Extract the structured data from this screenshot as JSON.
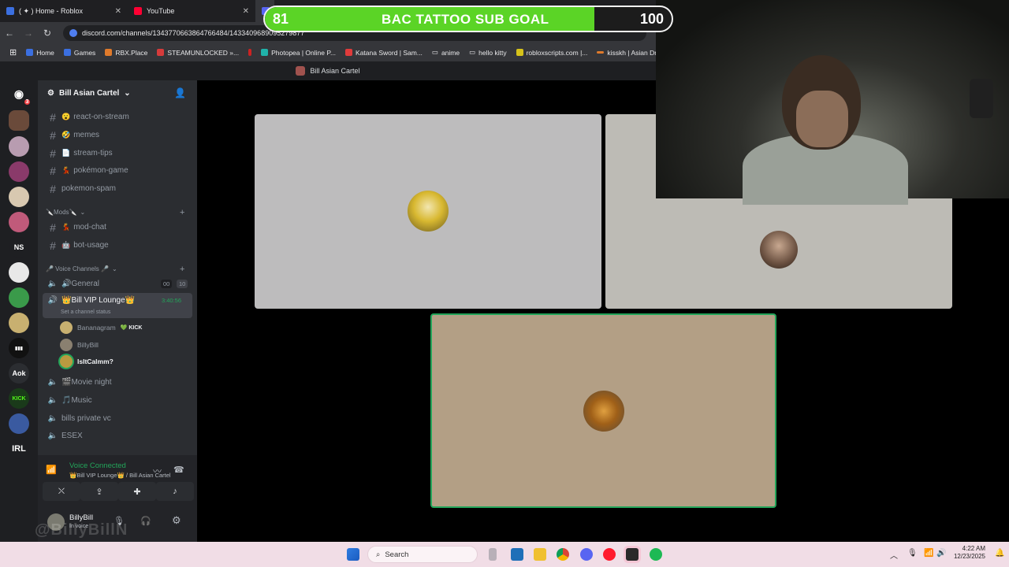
{
  "browser": {
    "tabs": [
      {
        "label": "( ✦ ) Home - Roblox",
        "color": "#3b6fe0"
      },
      {
        "label": "YouTube",
        "color": "#ff0033"
      }
    ],
    "url": "discord.com/channels/1343770663864766484/1433409689095279877",
    "bookmarks": [
      {
        "label": "Home",
        "color": "#3b6fe0"
      },
      {
        "label": "Games",
        "color": "#3b6fe0"
      },
      {
        "label": "RBX.Place",
        "color": "#e07a2b"
      },
      {
        "label": "STEAMUNLOCKED »...",
        "color": "#d63b3b"
      },
      {
        "label": "Photopea | Online P...",
        "color": "#20b2aa"
      },
      {
        "label": "Katana Sword | Sam...",
        "color": "#e03b3b"
      },
      {
        "label": "anime",
        "color": "folder"
      },
      {
        "label": "hello kitty",
        "color": "folder"
      },
      {
        "label": "robloxscripts.com |...",
        "color": "#d6c21a"
      },
      {
        "label": "kisskh | Asian Dram...",
        "color": "#e07a2b"
      }
    ]
  },
  "goal": {
    "current": "81",
    "title": "BAC TATTOO SUB GOAL",
    "target": "100",
    "progress": 0.81,
    "fill_color": "#5bd426"
  },
  "discord": {
    "window_title": "Bill Asian Cartel",
    "server_name": "Bill Asian Cartel",
    "text_channels": [
      {
        "emoji": "😮",
        "name": "react-on-stream"
      },
      {
        "emoji": "🤣",
        "name": "memes"
      },
      {
        "emoji": "📄",
        "name": "stream-tips"
      },
      {
        "emoji": "💃",
        "name": "pokémon-game"
      },
      {
        "emoji": "",
        "name": "pokemon-spam"
      }
    ],
    "mods_category": "🔪Mods🔪",
    "mod_channels": [
      {
        "emoji": "💃",
        "name": "mod-chat"
      },
      {
        "emoji": "🤖",
        "name": "bot-usage"
      }
    ],
    "voice_category": "🎤 Voice Channels 🎤",
    "general": {
      "name": "🔊General",
      "count_a": "00",
      "count_b": "10"
    },
    "vip": {
      "name": "👑Bill VIP Lounge👑",
      "timer": "3:40:56",
      "status": "Set a channel status"
    },
    "voice_users": [
      {
        "name": "Bananagram",
        "badge": "💚 KICK"
      },
      {
        "name": "BillyBill",
        "badge": ""
      },
      {
        "name": "IsItCalmm?",
        "badge": ""
      }
    ],
    "other_voice": [
      {
        "name": "🎬Movie night"
      },
      {
        "name": "🎵Music"
      },
      {
        "name": "bills private vc"
      },
      {
        "name": "ESEX"
      }
    ],
    "voice_connected": "Voice Connected",
    "voice_location": "👑Bill VIP Lounge👑 / Bill Asian Cartel",
    "username": "BillyBill",
    "user_status": "In voice",
    "server_labels": [
      "NS",
      "Aok",
      "IRL"
    ],
    "home_badge": "3"
  },
  "watermark": "@BillyBillN",
  "taskbar": {
    "search_placeholder": "Search",
    "time": "4:22 AM",
    "date": "12/23/2025"
  }
}
